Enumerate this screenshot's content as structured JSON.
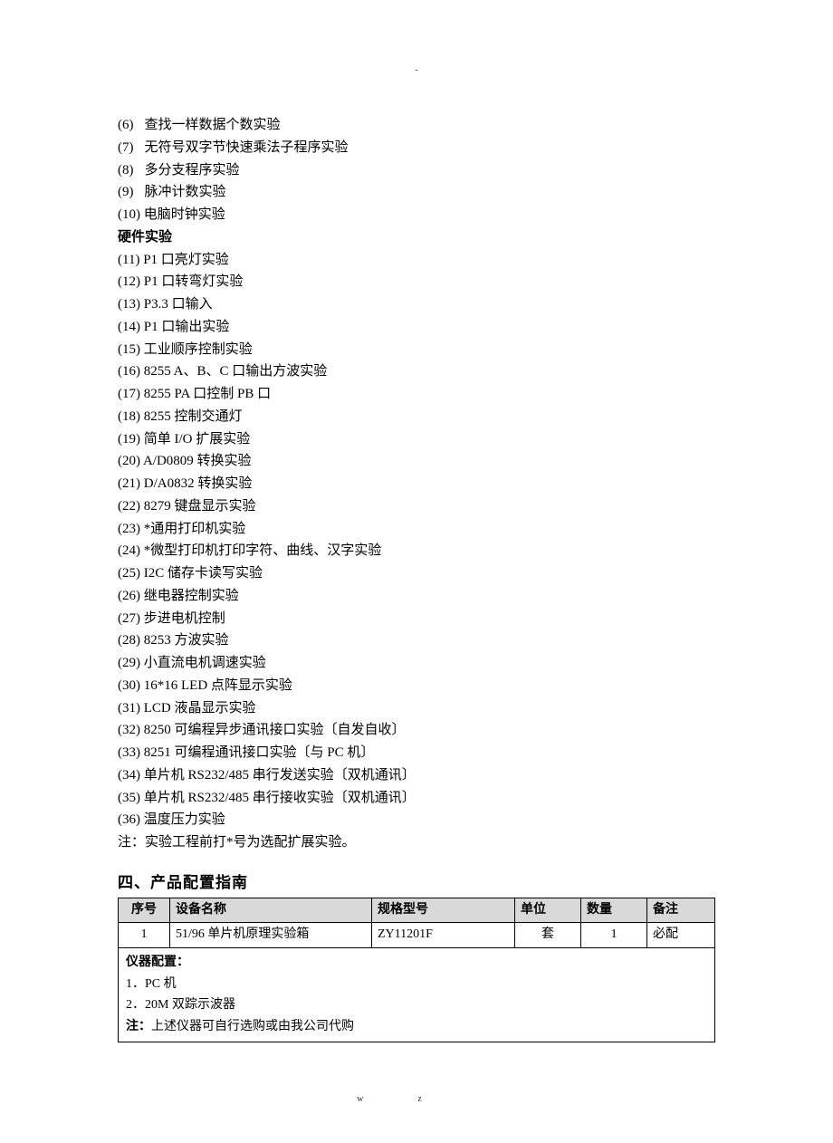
{
  "top_mark": "-",
  "footer_mark": "wz",
  "numbered_items_top": [
    {
      "idx": "(6)",
      "pad": true,
      "text": "查找一样数据个数实验"
    },
    {
      "idx": "(7)",
      "pad": true,
      "text": "无符号双字节快速乘法子程序实验"
    },
    {
      "idx": "(8)",
      "pad": true,
      "text": "多分支程序实验"
    },
    {
      "idx": "(9)",
      "pad": true,
      "text": "脉冲计数实验"
    },
    {
      "idx": "(10)",
      "pad": false,
      "text": "电脑时钟实验"
    }
  ],
  "hardware_heading": "硬件实验",
  "numbered_items_hw": [
    {
      "idx": "(11)",
      "text": "P1 口亮灯实验"
    },
    {
      "idx": "(12)",
      "text": "P1 口转弯灯实验"
    },
    {
      "idx": "(13)",
      "text": "P3.3 口输入"
    },
    {
      "idx": "(14)",
      "text": "P1 口输出实验"
    },
    {
      "idx": "(15)",
      "text": "工业顺序控制实验"
    },
    {
      "idx": "(16)",
      "text": "8255 A、B、C 口输出方波实验"
    },
    {
      "idx": "(17)",
      "text": "8255 PA 口控制 PB 口"
    },
    {
      "idx": "(18)",
      "text": "8255 控制交通灯"
    },
    {
      "idx": "(19)",
      "text": "简单 I/O 扩展实验"
    },
    {
      "idx": "(20)",
      "text": "A/D0809 转换实验"
    },
    {
      "idx": "(21)",
      "text": "D/A0832 转换实验"
    },
    {
      "idx": "(22)",
      "text": "8279 键盘显示实验"
    },
    {
      "idx": "(23)",
      "text": "*通用打印机实验"
    },
    {
      "idx": "(24)",
      "text": "*微型打印机打印字符、曲线、汉字实验"
    },
    {
      "idx": "(25)",
      "text": "I2C 储存卡读写实验"
    },
    {
      "idx": "(26)",
      "text": "继电器控制实验"
    },
    {
      "idx": "(27)",
      "text": "步进电机控制"
    },
    {
      "idx": "(28)",
      "text": "8253 方波实验"
    },
    {
      "idx": "(29)",
      "text": "小直流电机调速实验"
    },
    {
      "idx": "(30)",
      "text": "16*16 LED 点阵显示实验"
    },
    {
      "idx": "(31)",
      "text": "LCD 液晶显示实验"
    },
    {
      "idx": "(32)",
      "text": "8250 可编程异步通讯接口实验〔自发自收〕"
    },
    {
      "idx": "(33)",
      "text": "8251 可编程通讯接口实验〔与 PC 机〕"
    },
    {
      "idx": "(34)",
      "text": "单片机 RS232/485 串行发送实验〔双机通讯〕"
    },
    {
      "idx": "(35)",
      "text": "单片机 RS232/485 串行接收实验〔双机通讯〕"
    },
    {
      "idx": "(36)",
      "text": "温度压力实验"
    }
  ],
  "footnote": "注：实验工程前打*号为选配扩展实验。",
  "section4_heading": "四、产品配置指南",
  "table_headers": {
    "seq": "序号",
    "name": "设备名称",
    "model": "规格型号",
    "unit": "单位",
    "qty": "数量",
    "note": "备注"
  },
  "table_row": {
    "seq": "1",
    "name": "51/96 单片机原理实验箱",
    "model": "ZY11201F",
    "unit": "套",
    "qty": "1",
    "note": "必配"
  },
  "config_block": {
    "title": "仪器配置：",
    "line1": "1．PC 机",
    "line2": "2．20M 双踪示波器",
    "note_prefix": "注：",
    "note_text": "上述仪器可自行选购或由我公司代购"
  }
}
